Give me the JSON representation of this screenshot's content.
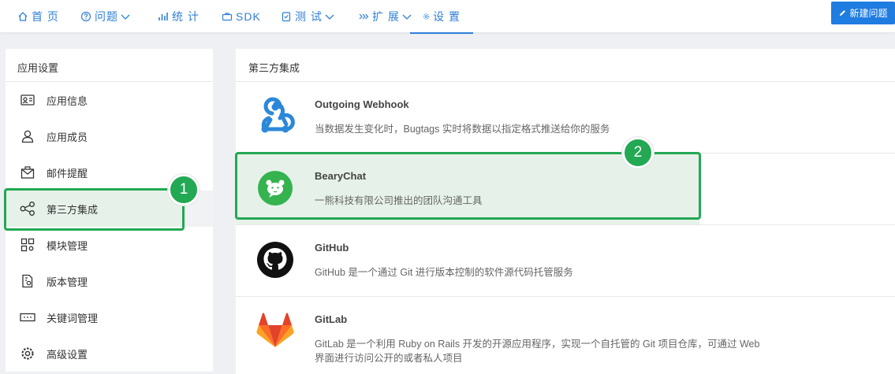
{
  "nav": {
    "items": [
      {
        "label": "首 页",
        "icon": "home-icon",
        "dropdown": false
      },
      {
        "label": "问题",
        "icon": "question-icon",
        "dropdown": true
      },
      {
        "label": "统 计",
        "icon": "bar-chart-icon",
        "dropdown": false
      },
      {
        "label": "SDK",
        "icon": "briefcase-icon",
        "dropdown": false
      },
      {
        "label": "测 试",
        "icon": "checklist-icon",
        "dropdown": true
      },
      {
        "label": "扩 展",
        "icon": "extension-icon",
        "dropdown": true
      },
      {
        "label": "设 置",
        "icon": "gear-icon",
        "dropdown": false,
        "active": true
      }
    ],
    "new_issue_label": "新建问题"
  },
  "sidebar": {
    "title": "应用设置",
    "items": [
      {
        "label": "应用信息",
        "icon": "id-card-icon"
      },
      {
        "label": "应用成员",
        "icon": "user-icon"
      },
      {
        "label": "邮件提醒",
        "icon": "mail-icon"
      },
      {
        "label": "第三方集成",
        "icon": "share-icon",
        "active": true
      },
      {
        "label": "模块管理",
        "icon": "modules-icon"
      },
      {
        "label": "版本管理",
        "icon": "version-file-icon"
      },
      {
        "label": "关键词管理",
        "icon": "keyword-icon"
      },
      {
        "label": "高级设置",
        "icon": "advanced-gear-icon"
      }
    ]
  },
  "main": {
    "title": "第三方集成",
    "integrations": [
      {
        "name": "Outgoing Webhook",
        "description": "当数据发生变化时，Bugtags 实时将数据以指定格式推送给你的服务",
        "icon": "webhook-icon"
      },
      {
        "name": "BearyChat",
        "description": "一熊科技有限公司推出的团队沟通工具",
        "icon": "bearychat-icon",
        "highlighted": true
      },
      {
        "name": "GitHub",
        "description": "GitHub 是一个通过 Git 进行版本控制的软件源代码托管服务",
        "icon": "github-icon"
      },
      {
        "name": "GitLab",
        "description": "GitLab 是一个利用 Ruby on Rails 开发的开源应用程序，实现一个自托管的 Git 项目仓库，可通过 Web 界面进行访问公开的或者私人项目",
        "icon": "gitlab-icon"
      }
    ]
  },
  "annotations": {
    "badge1": "1",
    "badge2": "2",
    "color": "#23a854"
  },
  "colors": {
    "accent": "#2f7fd8",
    "button": "#1f7ce0",
    "active_bg": "#e6f2e9"
  }
}
